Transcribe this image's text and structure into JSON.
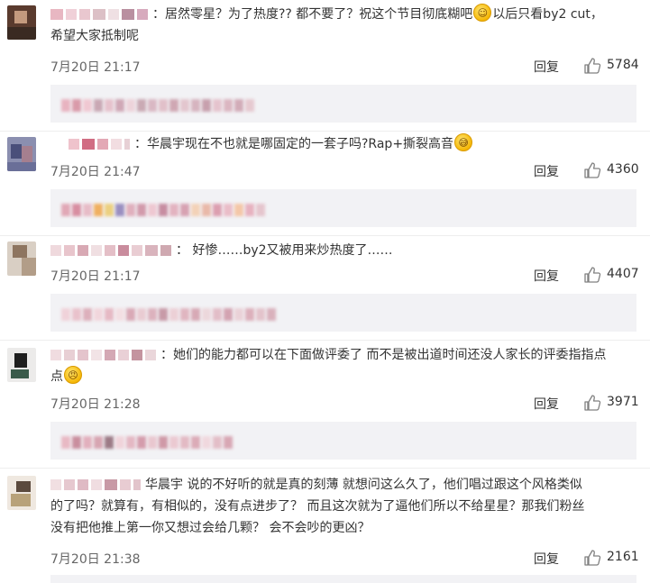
{
  "comments": [
    {
      "text1": "：居然零星？为了热度?? 都不要了？祝这个节目彻底糊吧",
      "text2": "以后只看by2 cut，",
      "text3": "希望大家抵制呢",
      "time": "7月20日 21:17",
      "reply": "回复",
      "likes": "5784"
    },
    {
      "text1": "：华晨宇现在不也就是哪固定的一套子吗?Rap+撕裂高音",
      "time": "7月20日 21:47",
      "reply": "回复",
      "likes": "4360"
    },
    {
      "text1": "： 好惨……by2又被用来炒热度了……",
      "time": "7月20日 21:17",
      "reply": "回复",
      "likes": "4407"
    },
    {
      "text1": "：她们的能力都可以在下面做评委了 而不是被出道时间还没人家长的评委指指点",
      "text2": "点",
      "time": "7月20日 21:28",
      "reply": "回复",
      "likes": "3971"
    },
    {
      "text1": "华晨宇  说的不好听的就是真的刻薄      就想问这么久了，他们唱过跟这个风格类似",
      "text2": "的了吗？就算有，有相似的，没有点进步了？  而且这次就为了逼他们所以不给星星？那我们粉丝",
      "text3": "没有把他推上第一你又想过会给几颗？  会不会吵的更凶？",
      "time": "7月20日 21:38",
      "reply": "回复",
      "likes": "2161"
    }
  ],
  "icons": {
    "like": "thumbs-up-icon",
    "emoji_grin": "grin-emoji-icon",
    "emoji_sweat": "sweat-emoji-icon",
    "emoji_angry": "angry-emoji-icon"
  },
  "colors": {
    "reply_bg": "#f2f2f5",
    "text": "#333333",
    "meta": "#666666"
  }
}
